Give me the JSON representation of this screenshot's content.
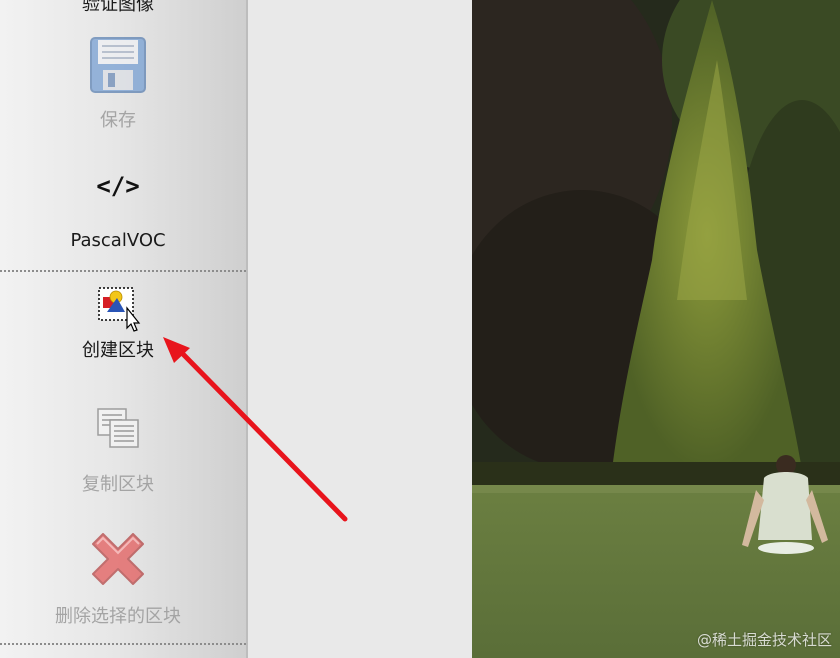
{
  "toolbar": {
    "verify_label": "验证图像",
    "save_label": "保存",
    "pascalvoc_label": "PascalVOC",
    "pascalvoc_glyph": "</>",
    "create_box_label": "创建区块",
    "copy_box_label": "复制区块",
    "delete_box_label": "删除选择的区块"
  },
  "watermark": "@稀土掘金技术社区",
  "icons": [
    "save-icon",
    "code-icon",
    "create-rect-icon",
    "copy-icon",
    "delete-icon"
  ],
  "colors": {
    "enabled_text": "#1a1a1a",
    "disabled_text": "#a4a4a4",
    "arrow": "#e8141c"
  }
}
